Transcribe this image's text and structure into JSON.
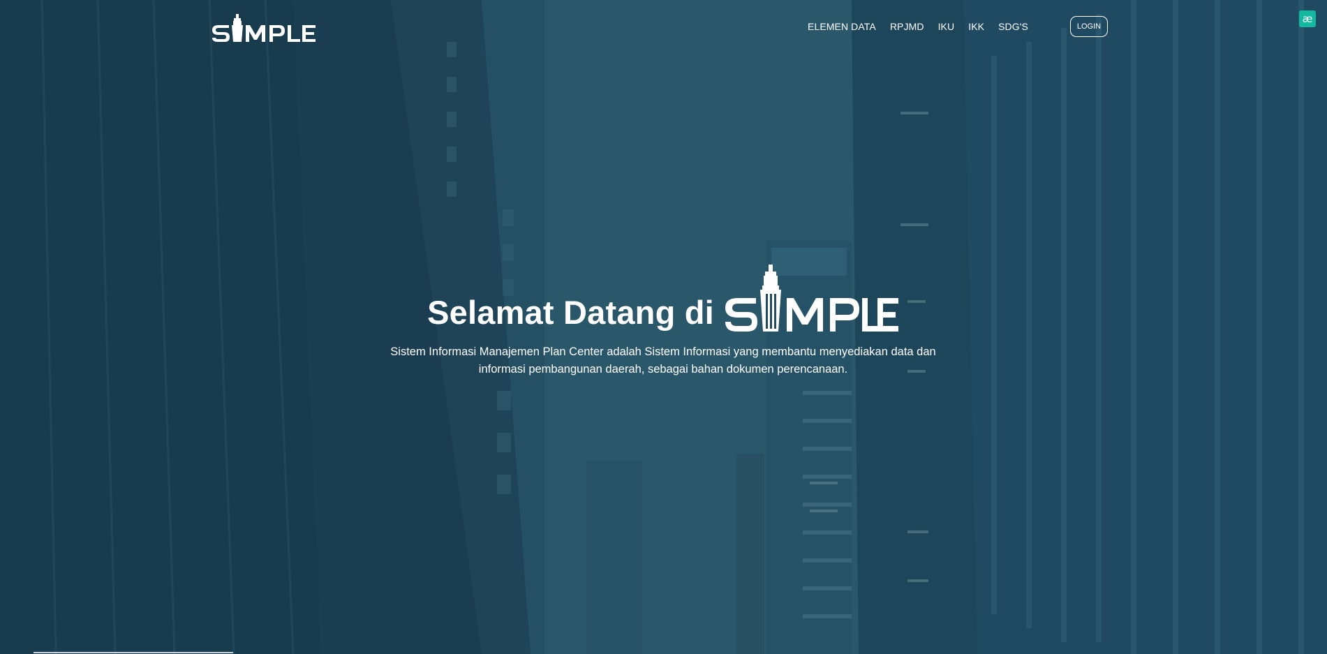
{
  "brand": {
    "logo_text": "SIMPLE"
  },
  "nav": {
    "items": [
      {
        "label": "ELEMEN DATA"
      },
      {
        "label": "RPJMD"
      },
      {
        "label": "IKU"
      },
      {
        "label": "IKK"
      },
      {
        "label": "SDG'S"
      }
    ],
    "login_label": "LOGIN"
  },
  "extension": {
    "badge_text": "æ"
  },
  "hero": {
    "title": "Selamat Datang di",
    "description": "Sistem Informasi Manajemen Plan Center adalah Sistem Informasi yang membantu menyediakan data dan informasi pembangunan daerah, sebagai bahan dokumen perencanaan."
  },
  "colors": {
    "overlay": "#234b60",
    "text": "#ffffff",
    "extension_badge": "#14b8a0"
  },
  "icons": {
    "logo": "simple-tower-logo",
    "extension": "extension-badge-icon"
  }
}
